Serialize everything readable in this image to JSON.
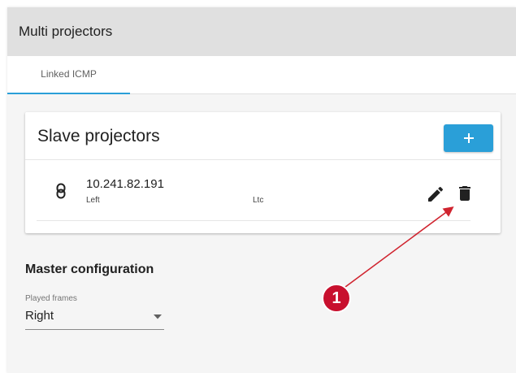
{
  "header": {
    "title": "Multi projectors"
  },
  "tabs": [
    {
      "label": "Linked ICMP",
      "active": true
    }
  ],
  "slave_card": {
    "title": "Slave projectors",
    "add_button": {
      "label": "+",
      "icon": "plus-icon"
    },
    "projectors": [
      {
        "ip": "10.241.82.191",
        "side": "Left",
        "mode": "Ltc",
        "icon": "link-icon"
      }
    ]
  },
  "master_config": {
    "title": "Master configuration",
    "played_frames": {
      "label": "Played frames",
      "value": "Right"
    }
  },
  "annotation": {
    "badge": "1",
    "color": "#c8102e"
  },
  "colors": {
    "accent": "#2a9fd8",
    "header_bg": "#e0e0e0",
    "panel_bg": "#f5f5f5"
  }
}
